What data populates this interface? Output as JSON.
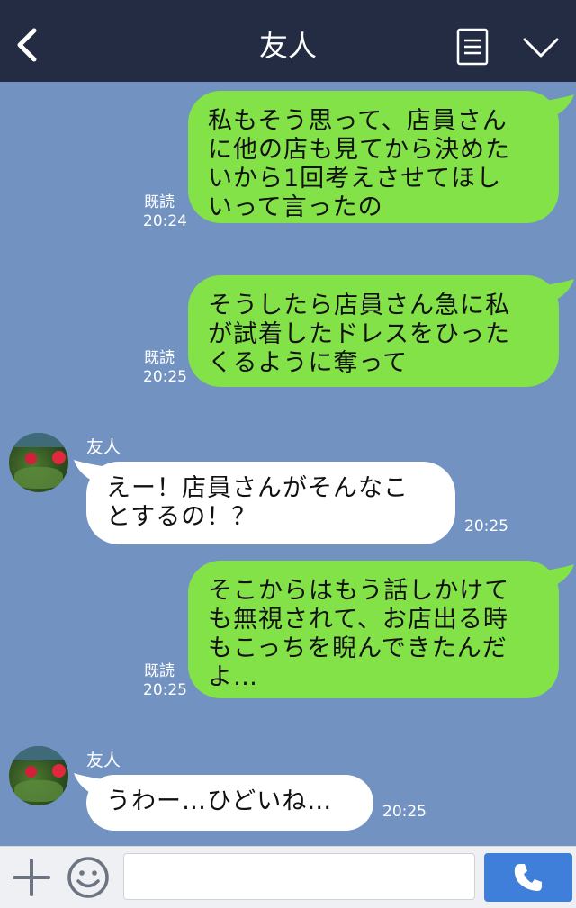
{
  "header": {
    "title": "友人",
    "back_icon": "chevron-left-icon",
    "menu_icon": "note-icon",
    "collapse_icon": "chevron-down-icon"
  },
  "messages": [
    {
      "direction": "sent",
      "lines": [
        "私もそう思って、店員さん",
        "に他の店も見てから決めた",
        "いから1回考えさせてほし",
        "いって言ったの"
      ],
      "read": "既読",
      "time": "20:24"
    },
    {
      "direction": "sent",
      "lines": [
        "そうしたら店員さん急に私",
        "が試着したドレスをひった",
        "くるように奪って"
      ],
      "read": "既読",
      "time": "20:25"
    },
    {
      "direction": "received",
      "sender": "友人",
      "lines": [
        "えー！店員さんがそんなこ",
        "とするの！？"
      ],
      "time": "20:25"
    },
    {
      "direction": "sent",
      "lines": [
        "そこからはもう話しかけて",
        "も無視されて、お店出る時",
        "もこっちを睨んできたんだ",
        "よ…"
      ],
      "read": "既読",
      "time": "20:25"
    },
    {
      "direction": "received",
      "sender": "友人",
      "lines": [
        "うわー…ひどいね…"
      ],
      "time": "20:25"
    }
  ],
  "footer": {
    "input_value": "",
    "plus_icon": "plus-icon",
    "emoji_icon": "smile-icon",
    "call_icon": "phone-icon"
  },
  "colors": {
    "header_bg": "#232c43",
    "chat_bg": "#7292c1",
    "sent_bubble": "#84e249",
    "received_bubble": "#ffffff",
    "call_button": "#3f7fd9"
  }
}
